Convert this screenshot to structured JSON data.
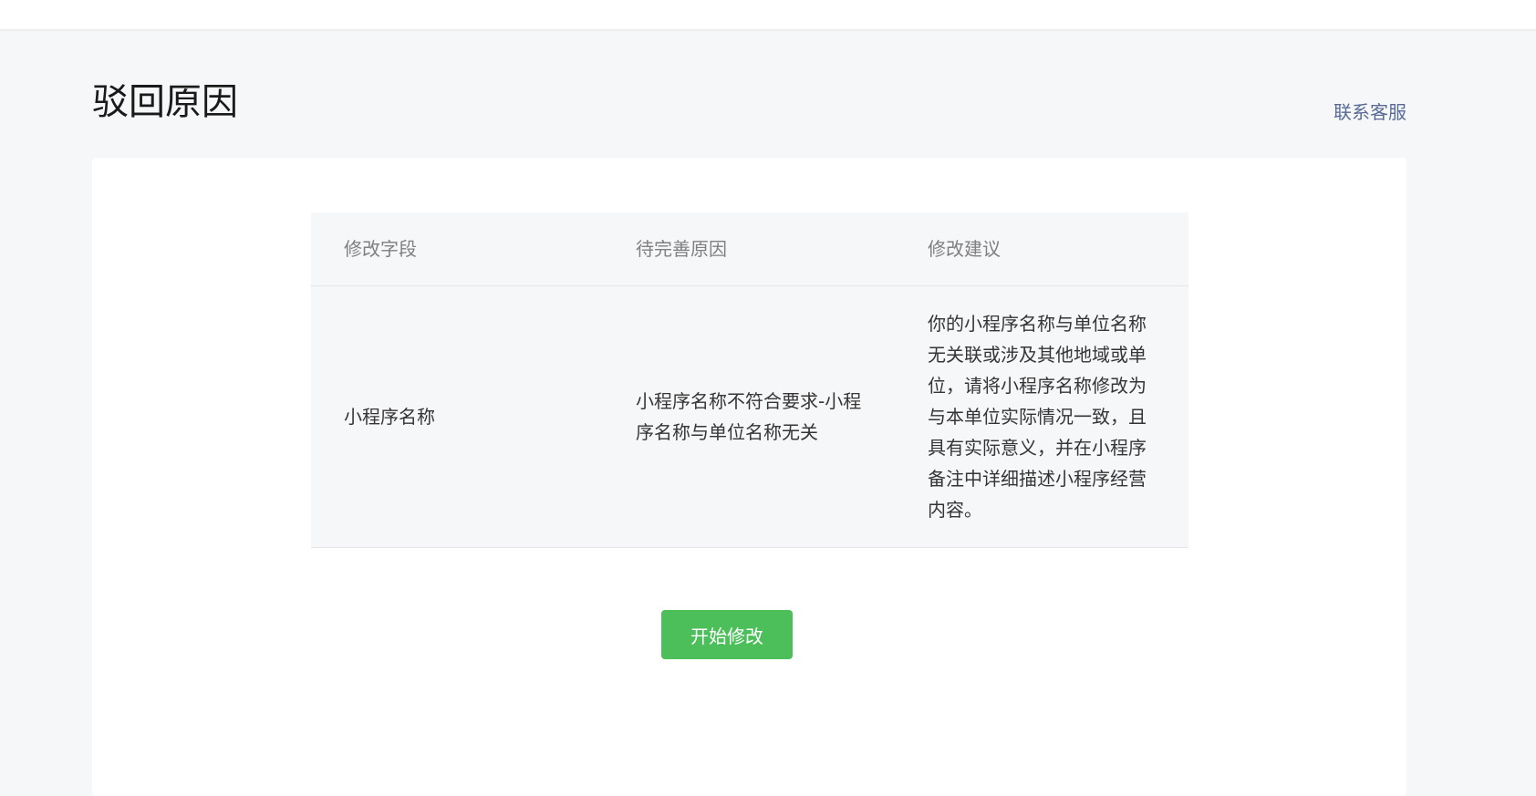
{
  "page": {
    "title": "驳回原因",
    "contact_link": "联系客服"
  },
  "table": {
    "headers": [
      "修改字段",
      "待完善原因",
      "修改建议"
    ],
    "rows": [
      {
        "field": "小程序名称",
        "reason": "小程序名称不符合要求-小程序名称与单位名称无关",
        "suggestion": "你的小程序名称与单位名称无关联或涉及其他地域或单位，请将小程序名称修改为与本单位实际情况一致，且具有实际意义，并在小程序备注中详细描述小程序经营内容。"
      }
    ]
  },
  "actions": {
    "start_label": "开始修改"
  },
  "colors": {
    "background": "#f6f7f9",
    "link": "#576b95",
    "primary_button": "#4cbf5b"
  }
}
